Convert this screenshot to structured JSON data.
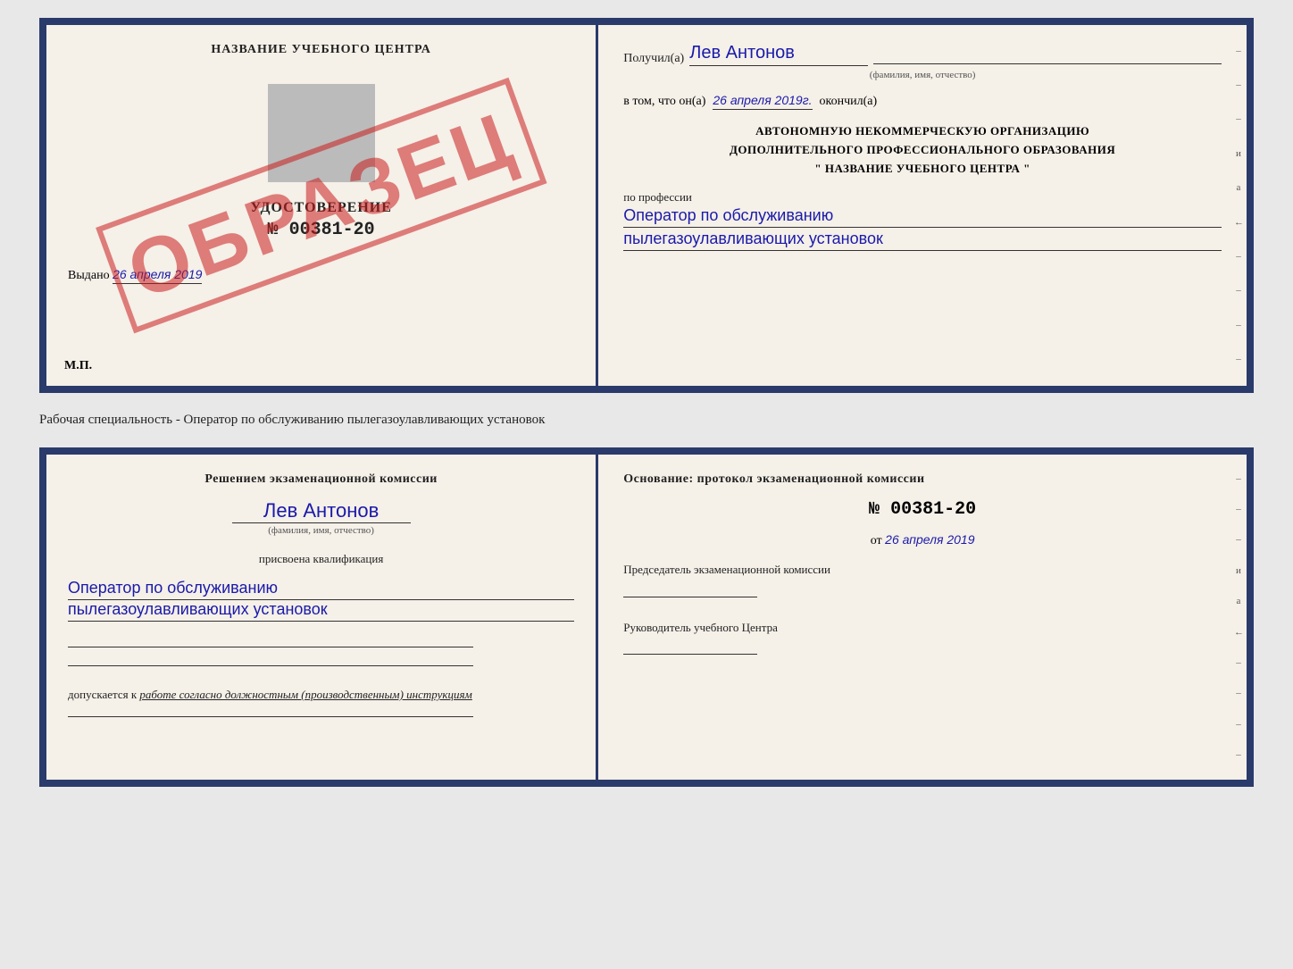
{
  "topCert": {
    "left": {
      "title": "НАЗВАНИЕ УЧЕБНОГО ЦЕНТРА",
      "stamp": "ОБРАЗЕЦ",
      "udostoverenie": "УДОСТОВЕРЕНИЕ",
      "number": "№ 00381-20",
      "vydano_label": "Выдано",
      "vydano_date": "26 апреля 2019",
      "mp": "М.П."
    },
    "right": {
      "poluchil_label": "Получил(а)",
      "recipient_name": "Лев Антонов",
      "fio_hint": "(фамилия, имя, отчество)",
      "vtom_label": "в том, что он(а)",
      "date_value": "26 апреля 2019г.",
      "okonchil_label": "окончил(а)",
      "org_line1": "АВТОНОМНУЮ НЕКОММЕРЧЕСКУЮ ОРГАНИЗАЦИЮ",
      "org_line2": "ДОПОЛНИТЕЛЬНОГО ПРОФЕССИОНАЛЬНОГО ОБРАЗОВАНИЯ",
      "org_line3": "\"  НАЗВАНИЕ УЧЕБНОГО ЦЕНТРА  \"",
      "po_professii": "по профессии",
      "profession_line1": "Оператор по обслуживанию",
      "profession_line2": "пылегазоулавливающих установок",
      "side_chars": [
        "–",
        "–",
        "–",
        "и",
        "а",
        "←",
        "–",
        "–",
        "–",
        "–"
      ]
    }
  },
  "middleText": "Рабочая специальность - Оператор по обслуживанию пылегазоулавливающих установок",
  "bottomCert": {
    "left": {
      "resheniye": "Решением экзаменационной комиссии",
      "name": "Лев Антонов",
      "fio_hint": "(фамилия, имя, отчество)",
      "prisvoena": "присвоена квалификация",
      "kval_line1": "Оператор по обслуживанию",
      "kval_line2": "пылегазоулавливающих установок",
      "dopuskaetsya": "допускается к",
      "dopusk_work": "работе согласно должностным (производственным) инструкциям"
    },
    "right": {
      "osnovaniye": "Основание: протокол экзаменационной комиссии",
      "number": "№ 00381-20",
      "ot_label": "от",
      "ot_date": "26 апреля 2019",
      "predsedatel_title": "Председатель экзаменационной комиссии",
      "rukovoditel_title": "Руководитель учебного Центра",
      "side_chars": [
        "–",
        "–",
        "–",
        "и",
        "а",
        "←",
        "–",
        "–",
        "–",
        "–"
      ]
    }
  }
}
